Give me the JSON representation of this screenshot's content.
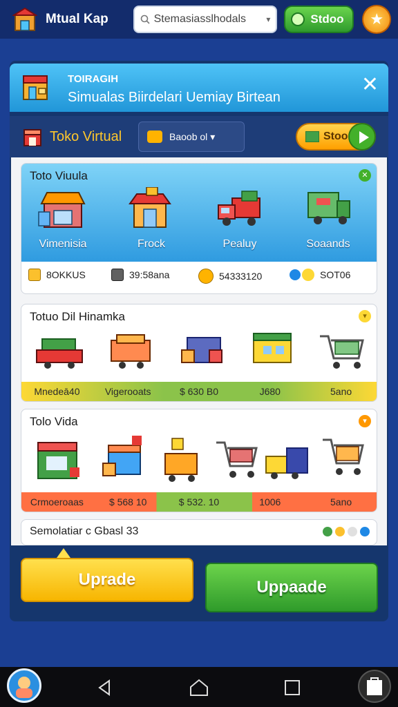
{
  "header": {
    "app_title": "Mtual Kap",
    "search_value": "Stemasiasslhodals",
    "store_label": "Stdoo",
    "star_icon": "star-icon"
  },
  "banner": {
    "title": "TOIRAGIH",
    "subtitle": "Simualas Biirdelari Uemiay Birtean",
    "close": "✕"
  },
  "toolbar": {
    "shop_name": "Toko Virtual",
    "select_label": "Baoob ol",
    "action_label": "Stoo"
  },
  "card1": {
    "title": "Toto Viuula",
    "items": [
      {
        "label": "Vimenisia",
        "icon": "shop-icon"
      },
      {
        "label": "Frock",
        "icon": "store-icon"
      },
      {
        "label": "Pealuy",
        "icon": "truck-icon"
      },
      {
        "label": "Soaands",
        "icon": "delivery-truck-icon"
      }
    ],
    "stats": [
      {
        "value": "8OKKUS",
        "icon": "coin-icon"
      },
      {
        "value": "39:58ana",
        "icon": "box-icon"
      },
      {
        "value": "54333120",
        "icon": "gold-icon"
      },
      {
        "value": "SOT06",
        "icon": "sun-icon"
      }
    ]
  },
  "card2": {
    "title": "Totuo Dil Hinamka",
    "strip": [
      "Mnedeā40",
      "Vigerooats",
      "$ 630 B0",
      "J680",
      "5ano"
    ]
  },
  "card3": {
    "title": "Tolo Vida",
    "strip": [
      "Crmoeroaas",
      "$ 568 10",
      "$ 532. 10",
      "1006",
      "5ano"
    ]
  },
  "footer_row": {
    "text": "Semolatiar c Gbasl 33"
  },
  "buttons": {
    "upgrade_left": "Uprade",
    "upgrade_right": "Uppaade"
  },
  "colors": {
    "background": "#1b3f93",
    "accent_yellow": "#ffc72c",
    "accent_green": "#43b02a",
    "banner_blue": "#2196d8"
  }
}
